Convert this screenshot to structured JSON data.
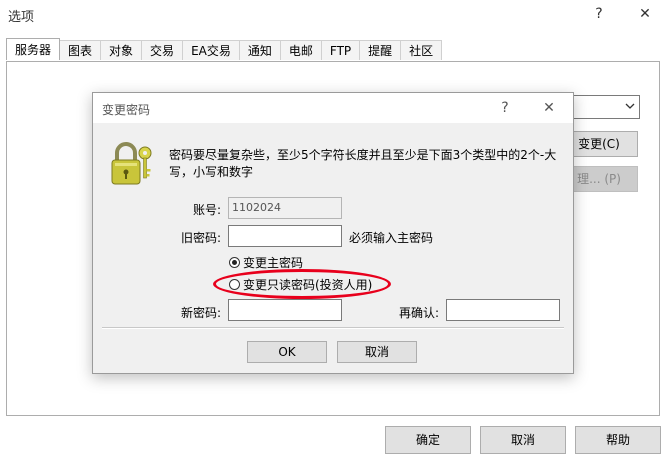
{
  "window": {
    "title": "选项",
    "help_glyph": "?",
    "close_glyph": "✕"
  },
  "tabs": [
    {
      "label": "服务器",
      "active": true
    },
    {
      "label": "图表"
    },
    {
      "label": "对象"
    },
    {
      "label": "交易"
    },
    {
      "label": "EA交易"
    },
    {
      "label": "通知"
    },
    {
      "label": "电邮"
    },
    {
      "label": "FTP"
    },
    {
      "label": "提醒"
    },
    {
      "label": "社区"
    }
  ],
  "background_panel": {
    "change_button": "变更(C)",
    "manage_button": "理... (P)"
  },
  "bottom_buttons": {
    "ok": "确定",
    "cancel": "取消",
    "help": "帮助"
  },
  "dialog": {
    "title": "变更密码",
    "help_glyph": "?",
    "close_glyph": "✕",
    "description": "密码要尽量复杂些，至少5个字符长度并且至少是下面3个类型中的2个-大写，小写和数字",
    "account_label": "账号:",
    "account_value": "1102024",
    "old_password_label": "旧密码:",
    "old_password_note": "必须输入主密码",
    "radio_master": "变更主密码",
    "radio_readonly": "变更只读密码(投资人用)",
    "new_password_label": "新密码:",
    "confirm_label": "再确认:",
    "ok_button": "OK",
    "cancel_button": "取消",
    "highlight_color": "#e8001c"
  }
}
